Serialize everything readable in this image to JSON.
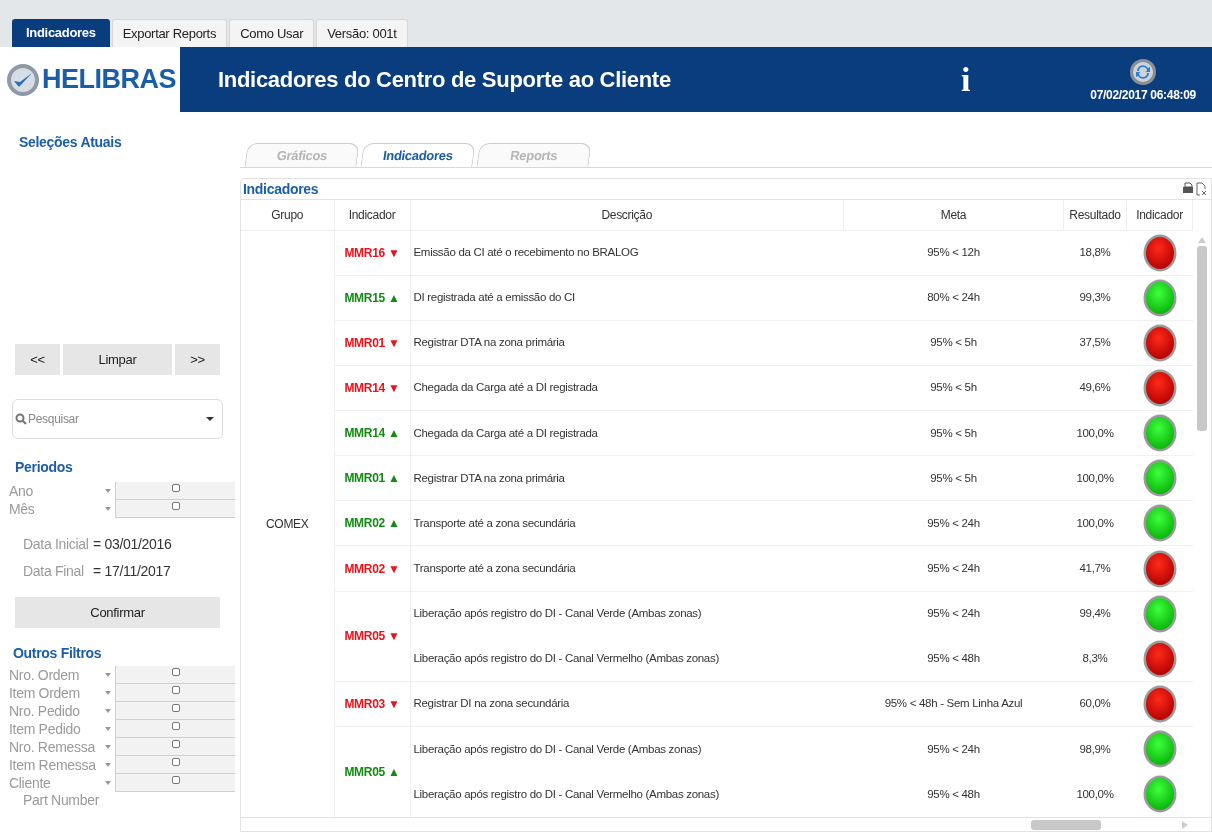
{
  "top_tabs": [
    {
      "label": "Indicadores",
      "selected": true
    },
    {
      "label": "Exportar Reports",
      "selected": false
    },
    {
      "label": "Como Usar",
      "selected": false
    },
    {
      "label": "Versão: 001t",
      "selected": false
    }
  ],
  "header": {
    "logo": "HELIBRAS",
    "title": "Indicadores do Centro de Suporte ao Cliente",
    "info": "i",
    "datetime": "07/02/2017 06:48:09"
  },
  "sidebar": {
    "current_selections": "Seleções Atuais",
    "nav_buttons": [
      "<<",
      "Limpar",
      ">>"
    ],
    "search": {
      "placeholder": "Pesquisar"
    },
    "periods": {
      "title": "Periodos",
      "filters": [
        "Ano",
        "Mês"
      ]
    },
    "dates": [
      {
        "label": "Data Inicial",
        "value": "= 03/01/2016"
      },
      {
        "label": "Data Final",
        "value": "= 17/11/2017"
      }
    ],
    "confirm": "Confirmar",
    "other_filters": {
      "title": "Outros Filtros",
      "filters": [
        "Nro. Ordem",
        "Item Ordem",
        "Nro. Pedido",
        "Item Pedido",
        "Nro. Remessa",
        "Item Remessa",
        "Cliente"
      ],
      "cut_label": "Part Number"
    }
  },
  "sheet_tabs": [
    {
      "label": "Gráficos",
      "selected": false
    },
    {
      "label": "Indicadores",
      "selected": true
    },
    {
      "label": "Reports",
      "selected": false
    }
  ],
  "table": {
    "title": "Indicadores",
    "columns": [
      "Grupo",
      "Indicador",
      "Descrição",
      "Meta",
      "Resultado",
      "Indicador"
    ],
    "groups": [
      {
        "name": "COMEX",
        "indicators": [
          {
            "code": "MMR16",
            "arrow": "▼",
            "met": false,
            "items": [
              {
                "description": "Emissão da CI até o recebimento no BRALOG",
                "meta": "95% < 12h",
                "result": "18,8%",
                "passed": false
              }
            ]
          },
          {
            "code": "MMR15",
            "arrow": "▲",
            "met": true,
            "items": [
              {
                "description": "DI registrada até a emissão do CI",
                "meta": "80% < 24h",
                "result": "99,3%",
                "passed": true
              }
            ]
          },
          {
            "code": "MMR01",
            "arrow": "▼",
            "met": false,
            "items": [
              {
                "description": "Registrar DTA na zona primária",
                "meta": "95% < 5h",
                "result": "37,5%",
                "passed": false
              }
            ]
          },
          {
            "code": "MMR14",
            "arrow": "▼",
            "met": false,
            "items": [
              {
                "description": "Chegada da Carga até a DI registrada",
                "meta": "95% < 5h",
                "result": "49,6%",
                "passed": false
              }
            ]
          },
          {
            "code": "MMR14",
            "arrow": "▲",
            "met": true,
            "items": [
              {
                "description": "Chegada da Carga até a DI registrada",
                "meta": "95% < 5h",
                "result": "100,0%",
                "passed": true
              }
            ]
          },
          {
            "code": "MMR01",
            "arrow": "▲",
            "met": true,
            "items": [
              {
                "description": "Registrar DTA na zona primária",
                "meta": "95% < 5h",
                "result": "100,0%",
                "passed": true
              }
            ]
          },
          {
            "code": "MMR02",
            "arrow": "▲",
            "met": true,
            "items": [
              {
                "description": "Transporte até a zona secundária",
                "meta": "95% < 24h",
                "result": "100,0%",
                "passed": true
              }
            ]
          },
          {
            "code": "MMR02",
            "arrow": "▼",
            "met": false,
            "items": [
              {
                "description": "Transporte até a zona secundária",
                "meta": "95% < 24h",
                "result": "41,7%",
                "passed": false
              }
            ]
          },
          {
            "code": "MMR05",
            "arrow": "▼",
            "met": false,
            "items": [
              {
                "description": "Liberação após registro do DI - Canal Verde (Ambas zonas)",
                "meta": "95% < 24h",
                "result": "99,4%",
                "passed": true
              },
              {
                "description": "Liberação após registro do DI - Canal Vermelho (Ambas zonas)",
                "meta": "95% < 48h",
                "result": "8,3%",
                "passed": false
              }
            ]
          },
          {
            "code": "MMR03",
            "arrow": "▼",
            "met": false,
            "items": [
              {
                "description": "Registrar DI na zona secundária",
                "meta": "95% < 48h - Sem Linha Azul",
                "result": "60,0%",
                "passed": false
              }
            ]
          },
          {
            "code": "MMR05",
            "arrow": "▲",
            "met": true,
            "items": [
              {
                "description": "Liberação após registro do DI - Canal Verde (Ambas zonas)",
                "meta": "95% < 24h",
                "result": "98,9%",
                "passed": true
              },
              {
                "description": "Liberação após registro do DI - Canal Vermelho (Ambas zonas)",
                "meta": "95% < 48h",
                "result": "100,0%",
                "passed": true
              }
            ]
          }
        ]
      }
    ]
  }
}
